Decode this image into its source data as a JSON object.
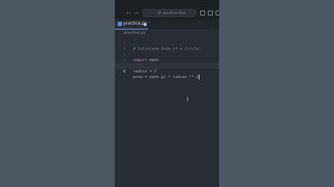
{
  "titlebar": {
    "back_icon": "arrow-left-icon",
    "forward_icon": "arrow-right-icon",
    "back_glyph": "←",
    "forward_glyph": "→",
    "search_icon": "search-icon",
    "search_glyph": "⚲",
    "search_placeholder": "practice-files",
    "panel_icons": [
      "sidebar-left-icon",
      "panel-bottom-icon",
      "sidebar-right-icon"
    ]
  },
  "tab": {
    "label": "practice.py",
    "icon": "python-file-icon",
    "modified_icon": "unsaved-dot-icon"
  },
  "breadcrumb": {
    "file": "practice.py"
  },
  "code": {
    "lines": [
      {
        "number": "1",
        "text": "# Calculate Area of a Circle:"
      },
      {
        "number": "2",
        "text": ""
      },
      {
        "number": "3",
        "keyword": "import",
        "rest": " math"
      },
      {
        "number": "4",
        "text": ""
      },
      {
        "number": "5",
        "lhs": "radius = ",
        "value": "5"
      },
      {
        "number": "6",
        "lhs": "area = math.pi * radius ",
        "op": "**",
        "value": " 2"
      }
    ]
  },
  "mouse_cursor": {
    "icon": "text-cursor-icon",
    "glyph": "I"
  },
  "colors": {
    "accent": "#6fa8ff",
    "editor_bg": "#282c34",
    "keyword": "#c678dd",
    "number": "#d19a66",
    "comment": "#7f848e"
  }
}
